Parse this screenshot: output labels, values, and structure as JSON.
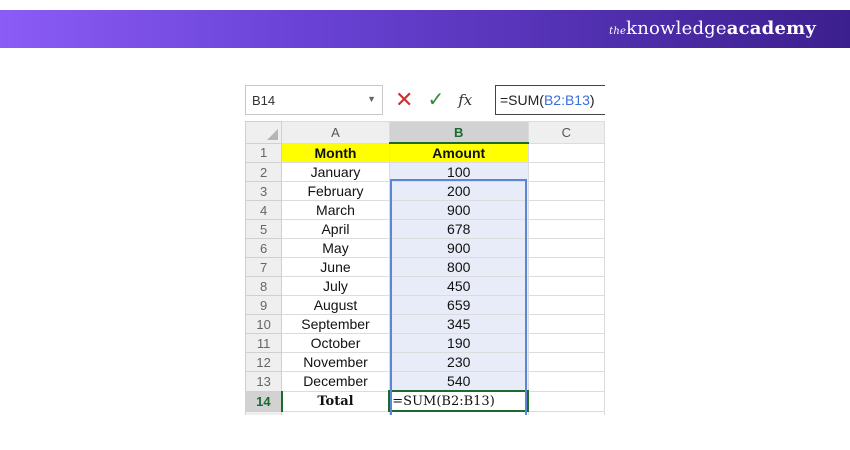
{
  "brand": {
    "the": "the",
    "knowledge": "knowledge",
    "academy": "academy"
  },
  "formula_bar": {
    "name_box": "B14",
    "cancel_icon": "x-icon",
    "enter_icon": "check-icon",
    "fx_label": "fx",
    "formula_prefix": "=SUM(",
    "formula_ref": "B2:B13",
    "formula_suffix": ")"
  },
  "columns": [
    "A",
    "B",
    "C"
  ],
  "header_row": {
    "row_number": "1",
    "month": "Month",
    "amount": "Amount"
  },
  "rows": [
    {
      "n": "2",
      "month": "January",
      "amount": "100"
    },
    {
      "n": "3",
      "month": "February",
      "amount": "200"
    },
    {
      "n": "4",
      "month": "March",
      "amount": "900"
    },
    {
      "n": "5",
      "month": "April",
      "amount": "678"
    },
    {
      "n": "6",
      "month": "May",
      "amount": "900"
    },
    {
      "n": "7",
      "month": "June",
      "amount": "800"
    },
    {
      "n": "8",
      "month": "July",
      "amount": "450"
    },
    {
      "n": "9",
      "month": "August",
      "amount": "659"
    },
    {
      "n": "10",
      "month": "September",
      "amount": "345"
    },
    {
      "n": "11",
      "month": "October",
      "amount": "190"
    },
    {
      "n": "12",
      "month": "November",
      "amount": "230"
    },
    {
      "n": "13",
      "month": "December",
      "amount": "540"
    }
  ],
  "total_row": {
    "n": "14",
    "label": "Total",
    "formula": "=SUM(B2:B13)"
  },
  "colors": {
    "accent_green": "#1b6b2e",
    "range_blue": "#5b86d6",
    "header_yellow": "#ffff00"
  }
}
